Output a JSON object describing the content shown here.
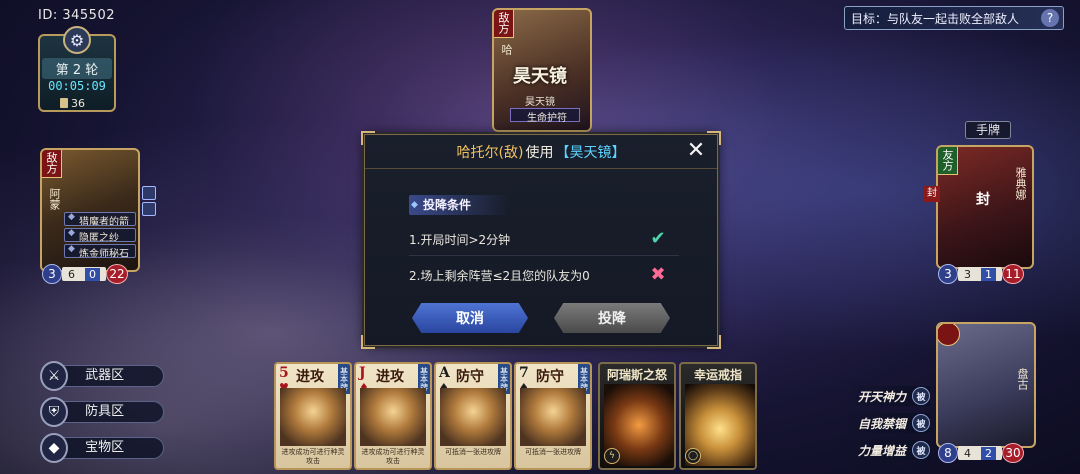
{
  "top_left": {
    "user_id": "ID: 345502",
    "round": "第 2 轮",
    "timer": "00:05:09",
    "deck_count": "36"
  },
  "objective": {
    "text": "目标：与队友一起击败全部敌人",
    "help": "?"
  },
  "boss": {
    "camp": "敌方",
    "name_short": "哈",
    "title": "昊天镜",
    "subtitle": "昊天镜",
    "equip": "生命护符"
  },
  "left_enemy": {
    "camp": "敌方",
    "name": "阿蒙",
    "skills": [
      "猎魔者的箭",
      "隐匿之纱",
      "炼金师秘石"
    ],
    "stat_left": "3",
    "stat_mid_a": "6",
    "stat_mid_b": "0",
    "stat_right": "22"
  },
  "right_ally": {
    "camp": "友方",
    "name": "雅典娜",
    "seal_tag": "封",
    "seal_center": "封",
    "stat_left": "3",
    "stat_mid_a": "3",
    "stat_mid_b": "1",
    "stat_right": "11"
  },
  "self_hero": {
    "name": "盘古",
    "stat_left": "8",
    "stat_mid_a": "4",
    "stat_mid_b": "2",
    "stat_right": "30"
  },
  "hand_label": "手牌",
  "modal": {
    "actor": "哈托尔(敌)",
    "verb": "使用",
    "item": "【昊天镜】",
    "conditions_header": "投降条件",
    "conditions": [
      {
        "text": "1.开局时间>2分钟",
        "met": true
      },
      {
        "text": "2.场上剩余阵营≤2且您的队友为0",
        "met": false
      }
    ],
    "cancel_label": "取消",
    "surrender_label": "投降"
  },
  "zones": [
    "武器区",
    "防具区",
    "宝物区"
  ],
  "hand_cards": [
    {
      "rank": "5",
      "suit": "♥",
      "red": true,
      "name": "进攻",
      "type": "基本牌",
      "desc": "进攻成功可进行种灵攻击"
    },
    {
      "rank": "J",
      "suit": "♦",
      "red": true,
      "name": "进攻",
      "type": "基本牌",
      "desc": "进攻成功可进行种灵攻击"
    },
    {
      "rank": "A",
      "suit": "♠",
      "red": false,
      "name": "防守",
      "type": "基本牌",
      "desc": "可抵消一张进攻牌"
    },
    {
      "rank": "7",
      "suit": "♠",
      "red": false,
      "name": "防守",
      "type": "基本牌",
      "desc": "可抵消一张进攻牌"
    }
  ],
  "special_cards": [
    {
      "name": "阿瑞斯之怒",
      "icon": "lightning-icon"
    },
    {
      "name": "幸运戒指",
      "icon": "ring-icon"
    }
  ],
  "skills": [
    {
      "name": "开天神力",
      "tag": "被"
    },
    {
      "name": "自我禁锢",
      "tag": "被"
    },
    {
      "name": "力量增益",
      "tag": "被"
    }
  ]
}
